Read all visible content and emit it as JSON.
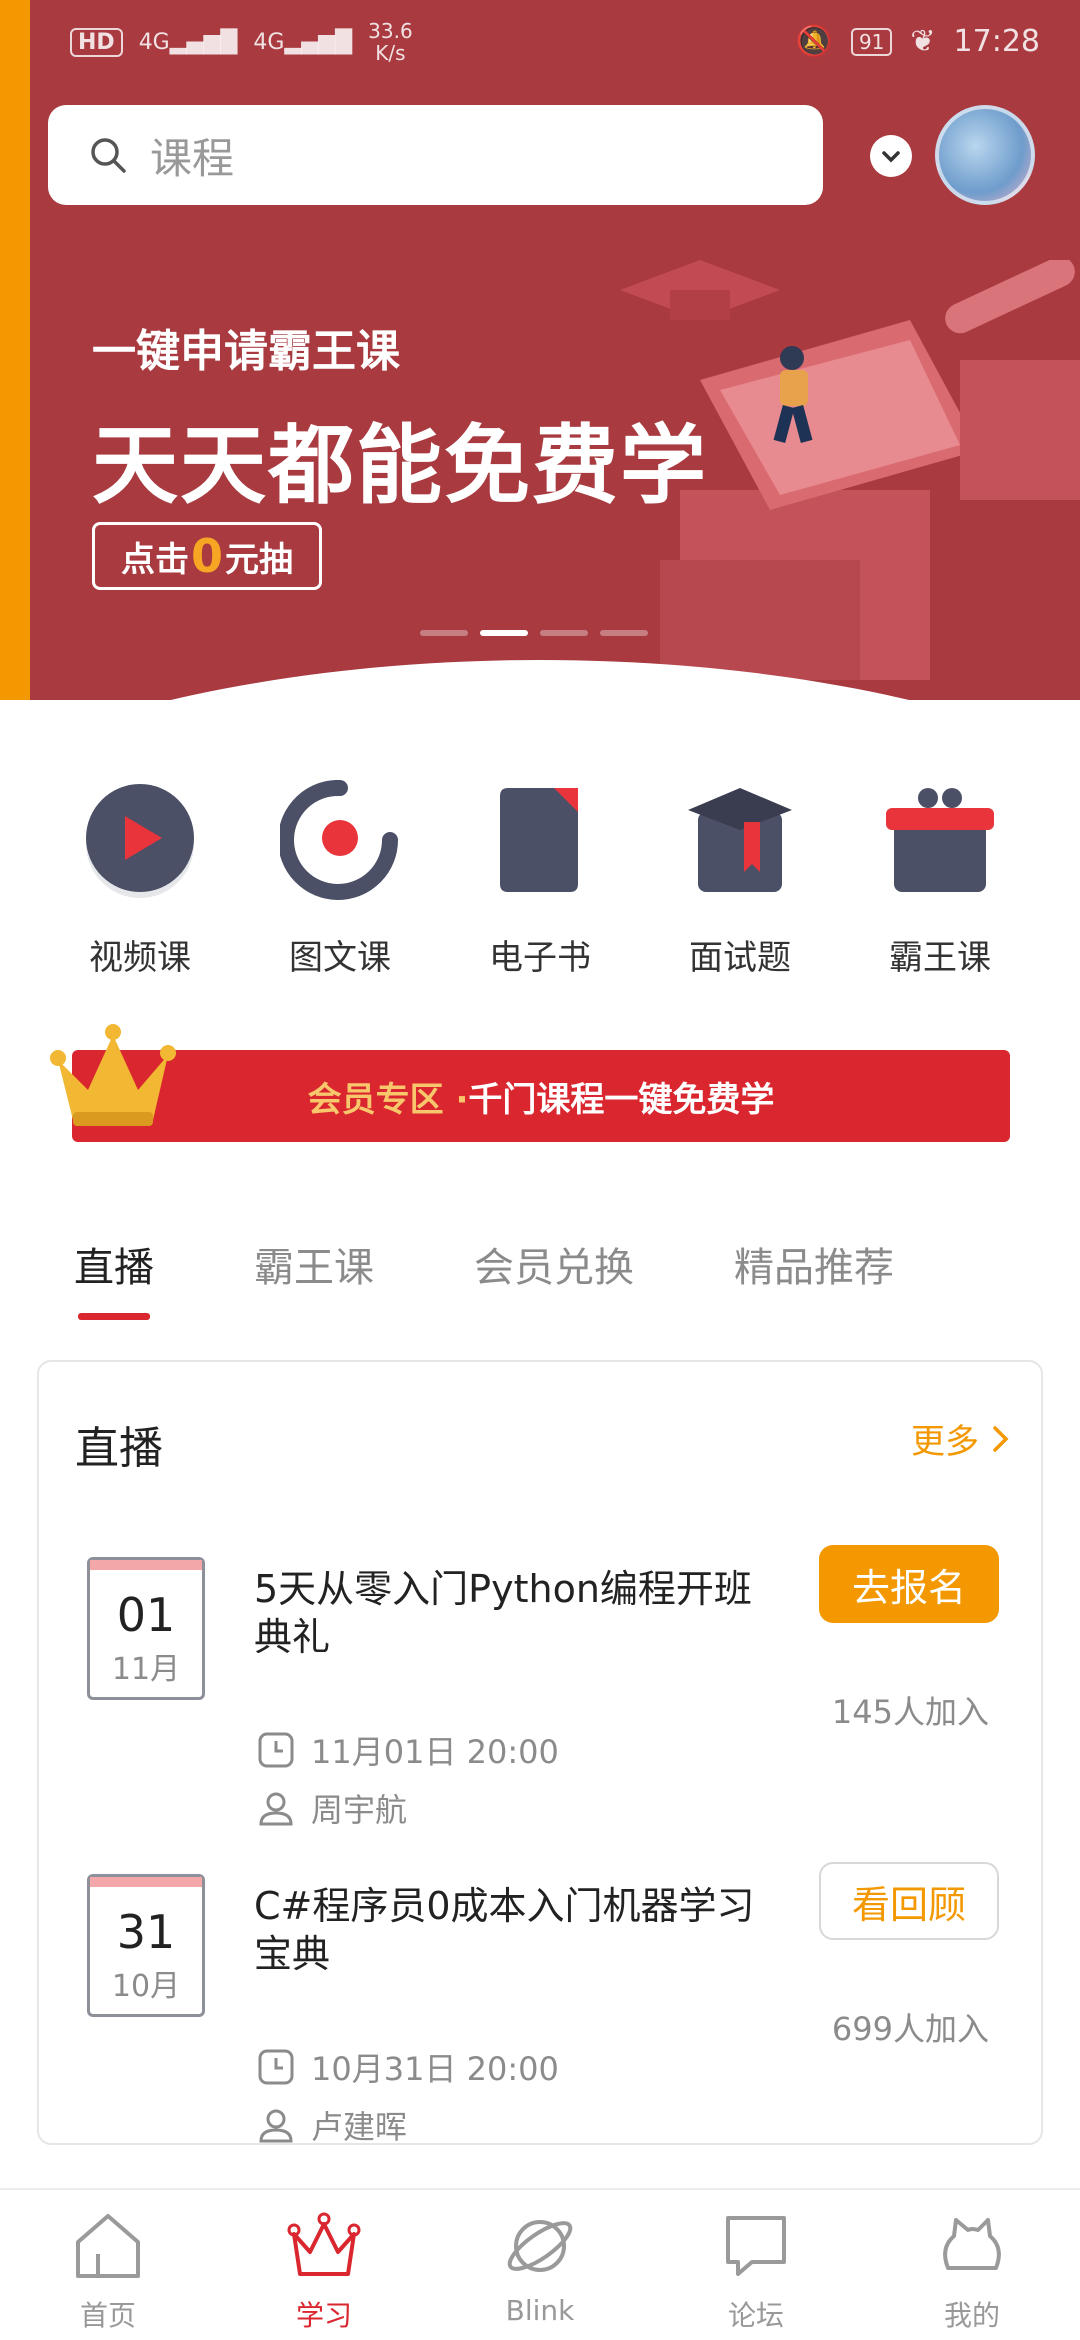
{
  "status_bar": {
    "hd": "HD",
    "net1": "4G",
    "net2": "4G",
    "speed_value": "33.6",
    "speed_unit": "K/s",
    "battery": "91",
    "time": "17:28"
  },
  "search": {
    "placeholder": "课程"
  },
  "banner": {
    "subtitle": "一键申请霸王课",
    "title": "天天都能免费学",
    "button_prefix": "点击",
    "button_zero": "0",
    "button_suffix": "元抽"
  },
  "categories": [
    {
      "label": "视频课",
      "icon": "play-icon"
    },
    {
      "label": "图文课",
      "icon": "ring-dot-icon"
    },
    {
      "label": "电子书",
      "icon": "document-icon"
    },
    {
      "label": "面试题",
      "icon": "graduation-box-icon"
    },
    {
      "label": "霸王课",
      "icon": "gift-icon"
    }
  ],
  "vip": {
    "part1": "会员专区 · ",
    "part2": "千门课程一键免费学"
  },
  "tabs": [
    "直播",
    "霸王课",
    "会员兑换",
    "精品推荐"
  ],
  "live": {
    "title": "直播",
    "more": "更多",
    "items": [
      {
        "day": "01",
        "month": "11月",
        "title": "5天从零入门Python编程开班典礼",
        "time": "11月01日 20:00",
        "teacher": "周宇航",
        "button": "去报名",
        "joined": "145人加入"
      },
      {
        "day": "31",
        "month": "10月",
        "title": "C#程序员0成本入门机器学习宝典",
        "time": "10月31日 20:00",
        "teacher": "卢建晖",
        "button": "看回顾",
        "joined": "699人加入"
      }
    ]
  },
  "bottom_nav": [
    {
      "label": "首页",
      "icon": "home-icon"
    },
    {
      "label": "学习",
      "icon": "crown-icon",
      "active": true
    },
    {
      "label": "Blink",
      "icon": "planet-icon"
    },
    {
      "label": "论坛",
      "icon": "chat-icon"
    },
    {
      "label": "我的",
      "icon": "profile-icon"
    }
  ],
  "colors": {
    "header_red": "#a83a40",
    "accent_orange": "#f39800",
    "brand_red": "#d9262f"
  }
}
